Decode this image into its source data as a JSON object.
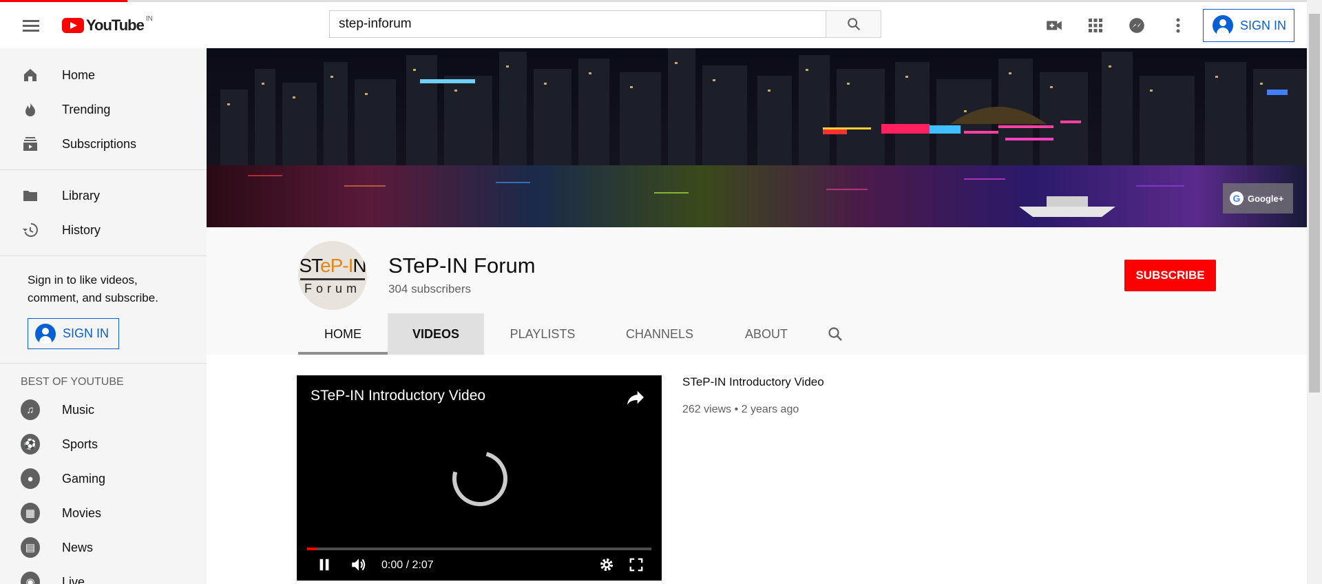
{
  "masthead": {
    "logo_text": "YouTube",
    "country_code": "IN",
    "search_value": "step-inforum",
    "signin_label": "SIGN IN",
    "icons": [
      "create-video-icon",
      "apps-icon",
      "messages-icon",
      "more-vert-icon"
    ]
  },
  "sidebar": {
    "primary": [
      {
        "label": "Home",
        "icon": "home-icon"
      },
      {
        "label": "Trending",
        "icon": "trending-icon"
      },
      {
        "label": "Subscriptions",
        "icon": "subscriptions-icon"
      }
    ],
    "secondary": [
      {
        "label": "Library",
        "icon": "library-icon"
      },
      {
        "label": "History",
        "icon": "history-icon"
      }
    ],
    "signin_text": "Sign in to like videos, comment, and subscribe.",
    "signin_label": "SIGN IN",
    "best_of_heading": "BEST OF YOUTUBE",
    "best_of": [
      {
        "label": "Music",
        "icon": "music-icon"
      },
      {
        "label": "Sports",
        "icon": "sports-icon"
      },
      {
        "label": "Gaming",
        "icon": "gaming-icon"
      },
      {
        "label": "Movies",
        "icon": "movies-icon"
      },
      {
        "label": "News",
        "icon": "news-icon"
      },
      {
        "label": "Live",
        "icon": "live-icon"
      }
    ]
  },
  "banner": {
    "gplus_label": "Google+"
  },
  "channel": {
    "name": "STeP-IN Forum",
    "subscribers": "304 subscribers",
    "subscribe_label": "SUBSCRIBE",
    "avatar_text_top": "STeP-IN",
    "avatar_text_bottom": "Forum",
    "tabs": [
      "HOME",
      "VIDEOS",
      "PLAYLISTS",
      "CHANNELS",
      "ABOUT"
    ],
    "active_tab": "HOME",
    "hover_tab": "VIDEOS"
  },
  "video": {
    "player_title": "STeP-IN Introductory Video",
    "time": "0:00 / 2:07",
    "progress": 0.0,
    "title": "STeP-IN Introductory Video",
    "meta": "262 views • 2 years ago"
  },
  "colors": {
    "brand": "#ff0000",
    "link": "#065fd4"
  }
}
